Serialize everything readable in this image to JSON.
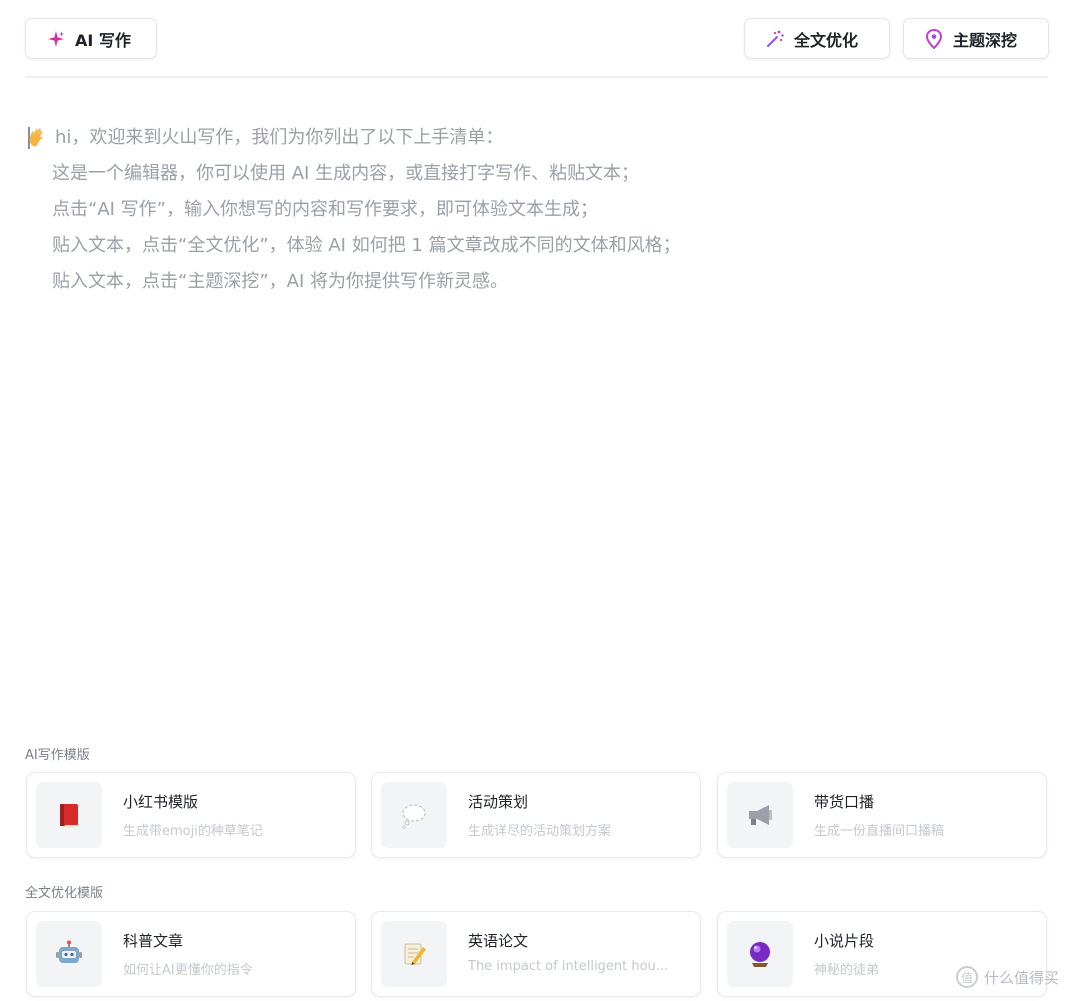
{
  "toolbar": {
    "ai_write_label": "AI 写作",
    "optimize_label": "全文优化",
    "deep_dig_label": "主题深挖",
    "accent_pink": "#e0309c",
    "accent_purple": "#8f4ef7"
  },
  "editor": {
    "lines": [
      "hi，欢迎来到火山写作，我们为你列出了以下上手清单：",
      "这是一个编辑器，你可以使用 AI 生成内容，或直接打字写作、粘贴文本；",
      "点击“AI 写作”，输入你想写的内容和写作要求，即可体验文本生成；",
      "贴入文本，点击“全文优化”，体验 AI 如何把 1 篇文章改成不同的文体和风格；",
      "贴入文本，点击“主题深挖”，AI 将为你提供写作新灵感。"
    ],
    "emoji": "waving-hand-icon"
  },
  "templates": {
    "ai_section_label": "AI写作模版",
    "optimize_section_label": "全文优化模版",
    "ai_cards": [
      {
        "title": "小红书模版",
        "desc": "生成带emoji的种草笔记",
        "icon": "red-book-icon"
      },
      {
        "title": "活动策划",
        "desc": "生成详尽的活动策划方案",
        "icon": "thought-bubble-icon"
      },
      {
        "title": "带货口播",
        "desc": "生成一份直播间口播稿",
        "icon": "megaphone-icon"
      }
    ],
    "optimize_cards": [
      {
        "title": "科普文章",
        "desc": "如何让AI更懂你的指令",
        "icon": "robot-icon"
      },
      {
        "title": "英语论文",
        "desc": "The impact of intelligent hou...",
        "icon": "memo-icon"
      },
      {
        "title": "小说片段",
        "desc": "神秘的徒弟",
        "icon": "crystal-ball-icon"
      }
    ]
  },
  "watermark": {
    "text": "什么值得买",
    "icon_glyph": "值"
  }
}
